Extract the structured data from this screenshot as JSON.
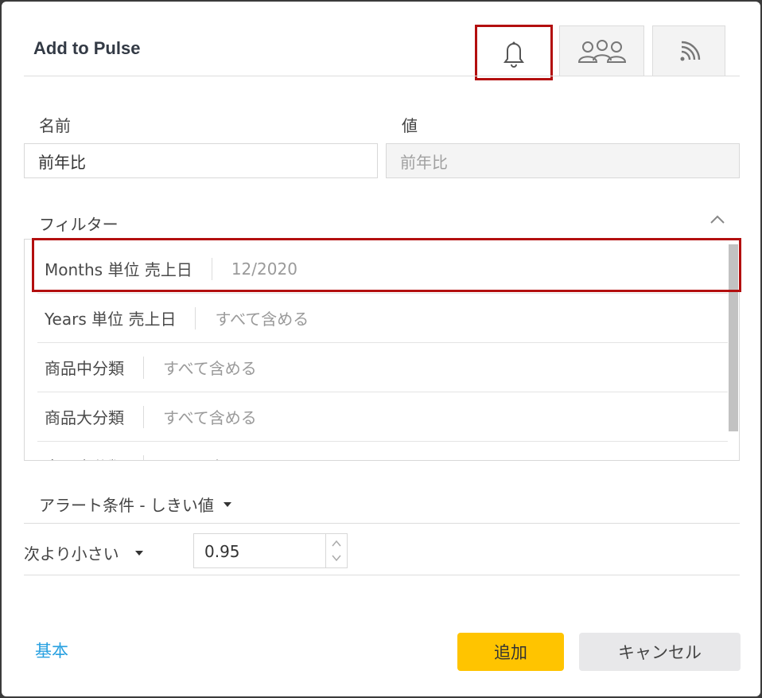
{
  "dialog": {
    "title": "Add to Pulse"
  },
  "tabs": [
    {
      "name": "notification",
      "icon": "bell-icon",
      "active": true
    },
    {
      "name": "users",
      "icon": "users-icon",
      "active": false
    },
    {
      "name": "feed",
      "icon": "rss-icon",
      "active": false
    }
  ],
  "form": {
    "name_label": "名前",
    "name_value": "前年比",
    "value_label": "値",
    "value_value": "前年比"
  },
  "filters": {
    "title": "フィルター",
    "items": [
      {
        "name": "Months 単位 売上日",
        "value": "12/2020"
      },
      {
        "name": "Years 単位 売上日",
        "value": "すべて含める"
      },
      {
        "name": "商品中分類",
        "value": "すべて含める"
      },
      {
        "name": "商品大分類",
        "value": "すべて含める"
      },
      {
        "name": "商品小分類",
        "value": "すべて含める"
      }
    ]
  },
  "alert": {
    "condition_label": "アラート条件 -  しきい値",
    "comparison": "次より小さい",
    "threshold": "0.95"
  },
  "footer": {
    "basic_link": "基本",
    "add_label": "追加",
    "cancel_label": "キャンセル"
  },
  "colors": {
    "accent": "#ffc400",
    "link": "#27a0e0",
    "highlight": "#b30f0f"
  }
}
